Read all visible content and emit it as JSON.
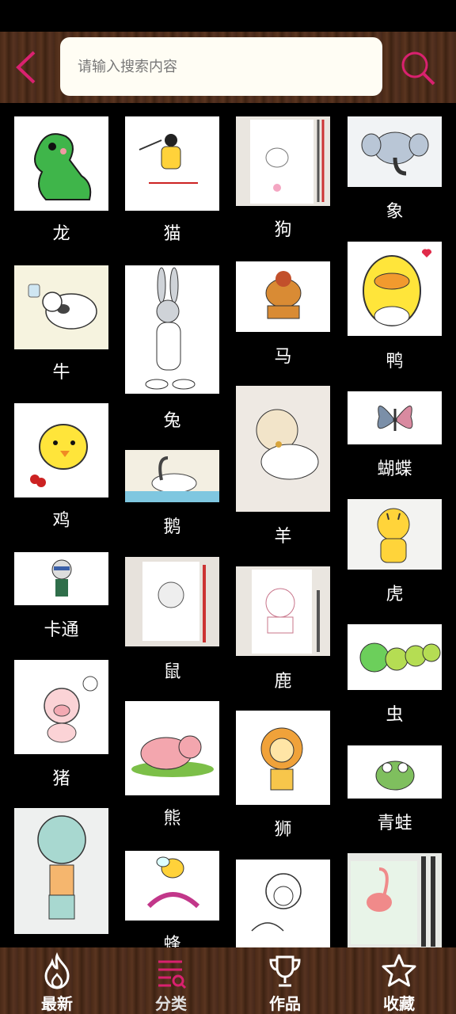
{
  "header": {
    "search_placeholder": "请输入搜索内容",
    "accent_color": "#d9216f"
  },
  "categories": [
    {
      "label": "龙",
      "icon": "dinosaur-drawing"
    },
    {
      "label": "猫",
      "icon": "cat-drawing"
    },
    {
      "label": "狗",
      "icon": "dog-sketch"
    },
    {
      "label": "象",
      "icon": "elephant-drawing"
    },
    {
      "label": "牛",
      "icon": "cow-drawing"
    },
    {
      "label": "兔",
      "icon": "rabbit-drawing"
    },
    {
      "label": "马",
      "icon": "horse-drawing"
    },
    {
      "label": "鸭",
      "icon": "duck-drawing"
    },
    {
      "label": "鸡",
      "icon": "chick-drawing"
    },
    {
      "label": "鹅",
      "icon": "swan-drawing"
    },
    {
      "label": "羊",
      "icon": "sheep-drawing"
    },
    {
      "label": "蝴蝶",
      "icon": "butterfly-drawing"
    },
    {
      "label": "卡通",
      "icon": "cartoon-ninja-drawing"
    },
    {
      "label": "鼠",
      "icon": "mouse-sketch"
    },
    {
      "label": "鹿",
      "icon": "deer-sketch"
    },
    {
      "label": "虎",
      "icon": "tiger-drawing"
    },
    {
      "label": "猪",
      "icon": "pig-drawing"
    },
    {
      "label": "熊",
      "icon": "bear-drawing"
    },
    {
      "label": "狮",
      "icon": "lion-drawing"
    },
    {
      "label": "虫",
      "icon": "caterpillar-drawing"
    },
    {
      "label": "蜂",
      "icon": "bee-drawing"
    },
    {
      "label": "青蛙",
      "icon": "frog-drawing"
    }
  ],
  "tabs": [
    {
      "label": "最新",
      "icon": "flame-icon"
    },
    {
      "label": "分类",
      "icon": "category-list-icon",
      "active": true
    },
    {
      "label": "作品",
      "icon": "trophy-icon"
    },
    {
      "label": "收藏",
      "icon": "star-icon"
    }
  ]
}
